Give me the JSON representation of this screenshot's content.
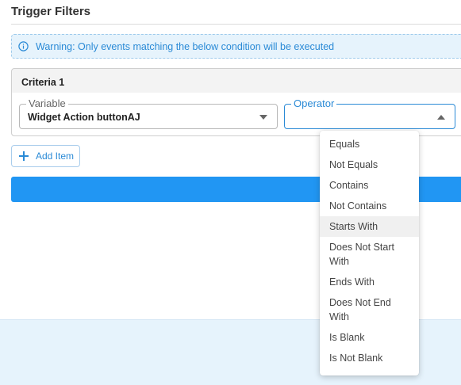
{
  "page": {
    "title": "Trigger Filters"
  },
  "warning": {
    "icon": "info-icon",
    "text": "Warning: Only events matching the below condition will be executed"
  },
  "criteria": {
    "heading": "Criteria 1",
    "variable": {
      "label": "Variable",
      "value": "Widget Action buttonAJ"
    },
    "operator": {
      "label": "Operator",
      "value": ""
    }
  },
  "actions": {
    "add_item_label": "Add Item"
  },
  "operator_menu": {
    "highlighted_index": 4,
    "options": [
      "Equals",
      "Not Equals",
      "Contains",
      "Not Contains",
      "Starts With",
      "Does Not Start With",
      "Ends With",
      "Does Not End With",
      "Is Blank",
      "Is Not Blank"
    ]
  },
  "colors": {
    "accent": "#2196f3",
    "link": "#2a8ad6",
    "warning_bg": "#e6f3fc"
  }
}
